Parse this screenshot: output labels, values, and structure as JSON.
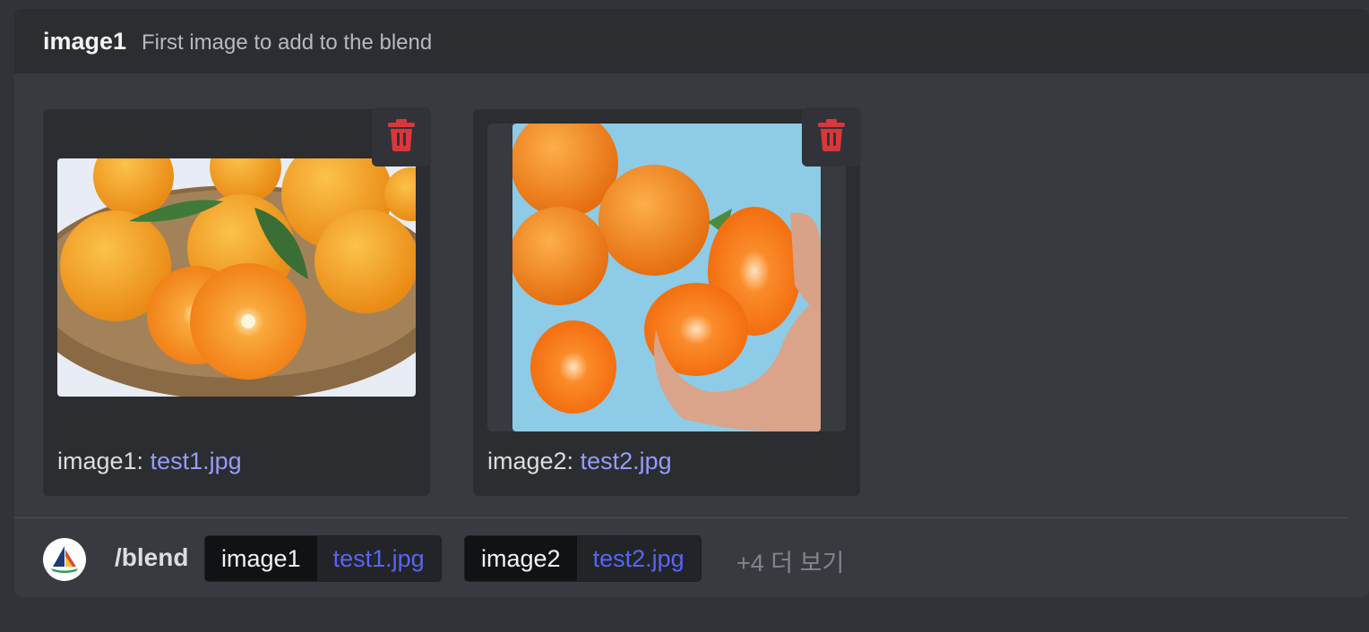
{
  "option_header": {
    "name": "image1",
    "description": "First image to add to the blend"
  },
  "attachments": [
    {
      "option": "image1:",
      "filename": "test1.jpg",
      "delete_icon": "trash-icon"
    },
    {
      "option": "image2:",
      "filename": "test2.jpg",
      "delete_icon": "trash-icon"
    }
  ],
  "command_bar": {
    "command": "/blend",
    "params": [
      {
        "name": "image1",
        "value": "test1.jpg"
      },
      {
        "name": "image2",
        "value": "test2.jpg"
      }
    ],
    "more": "+4 더 보기"
  },
  "colors": {
    "accent_link": "#949cf7",
    "chip_value": "#5865f2",
    "danger": "#da373c"
  }
}
